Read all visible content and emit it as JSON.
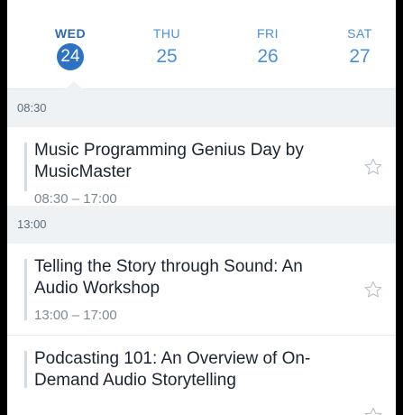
{
  "days": [
    {
      "name": "WED",
      "number": "24",
      "selected": true
    },
    {
      "name": "THU",
      "number": "25",
      "selected": false
    },
    {
      "name": "FRI",
      "number": "26",
      "selected": false
    },
    {
      "name": "SAT",
      "number": "27",
      "selected": false
    }
  ],
  "schedule": [
    {
      "time_header": "08:30",
      "sessions": [
        {
          "title": "Music Programming Genius Day by MusicMaster",
          "time": "08:30 – 17:00",
          "starred": false
        }
      ]
    },
    {
      "time_header": "13:00",
      "sessions": [
        {
          "title": "Telling the Story through Sound: An Audio Workshop",
          "time": "13:00 – 17:00",
          "starred": false
        },
        {
          "title": "Podcasting 101: An Overview of On-Demand Audio Storytelling",
          "time": "",
          "starred": false
        }
      ]
    }
  ],
  "icons": {
    "star": "star-outline-icon"
  },
  "colors": {
    "accent": "#4a90d9",
    "selected_day_bg": "#2f72c4",
    "section_bg": "#eff2f5"
  }
}
